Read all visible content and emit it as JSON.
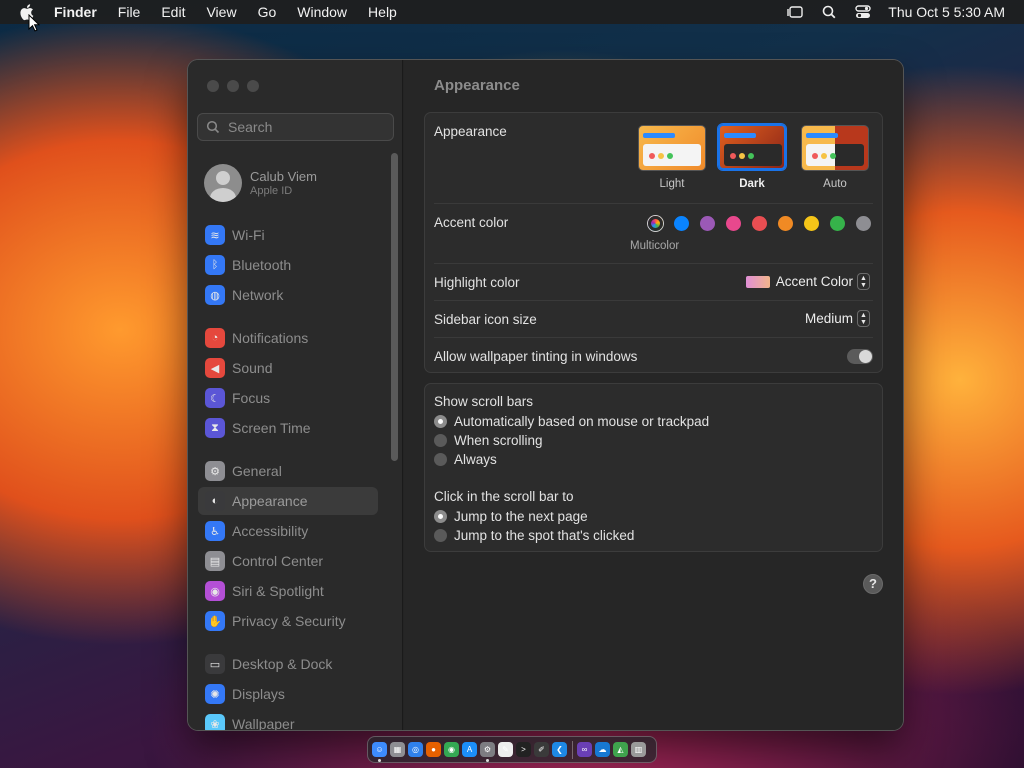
{
  "menubar": {
    "app": "Finder",
    "menus": [
      "File",
      "Edit",
      "View",
      "Go",
      "Window",
      "Help"
    ],
    "clock": "Thu Oct 5  5:30 AM"
  },
  "window": {
    "title": "Appearance",
    "search_placeholder": "Search",
    "account": {
      "name": "Calub Viem",
      "sub": "Apple ID"
    },
    "sidebar_items": [
      {
        "label": "Wi-Fi",
        "icon": "wifi-icon",
        "color": "#3478f6",
        "glyph": "≋"
      },
      {
        "label": "Bluetooth",
        "icon": "bluetooth-icon",
        "color": "#3478f6",
        "glyph": "ᛒ"
      },
      {
        "label": "Network",
        "icon": "globe-icon",
        "color": "#3478f6",
        "glyph": "◍"
      },
      {
        "label": "Notifications",
        "icon": "bell-icon",
        "color": "#e5483d",
        "glyph": "◔"
      },
      {
        "label": "Sound",
        "icon": "speaker-icon",
        "color": "#e5483d",
        "glyph": "◀"
      },
      {
        "label": "Focus",
        "icon": "moon-icon",
        "color": "#5b56d6",
        "glyph": "☾"
      },
      {
        "label": "Screen Time",
        "icon": "hourglass-icon",
        "color": "#5b56d6",
        "glyph": "⧗"
      },
      {
        "label": "General",
        "icon": "gear-icon",
        "color": "#8e8e93",
        "glyph": "⚙"
      },
      {
        "label": "Appearance",
        "icon": "appearance-icon",
        "color": "#3a3a3c",
        "glyph": "◐"
      },
      {
        "label": "Accessibility",
        "icon": "accessibility-icon",
        "color": "#3478f6",
        "glyph": "♿"
      },
      {
        "label": "Control Center",
        "icon": "control-center-icon",
        "color": "#8e8e93",
        "glyph": "▤"
      },
      {
        "label": "Siri & Spotlight",
        "icon": "siri-icon",
        "color": "#b44fd6",
        "glyph": "◉"
      },
      {
        "label": "Privacy & Security",
        "icon": "hand-icon",
        "color": "#3478f6",
        "glyph": "✋"
      },
      {
        "label": "Desktop & Dock",
        "icon": "dock-icon",
        "color": "#3a3a3c",
        "glyph": "▭"
      },
      {
        "label": "Displays",
        "icon": "sun-icon",
        "color": "#3478f6",
        "glyph": "✺"
      },
      {
        "label": "Wallpaper",
        "icon": "wallpaper-icon",
        "color": "#5ac8fa",
        "glyph": "❀"
      }
    ],
    "appearance": {
      "label": "Appearance",
      "options": [
        "Light",
        "Dark",
        "Auto"
      ],
      "selected": "Dark"
    },
    "accent": {
      "label": "Accent color",
      "multicolor_label": "Multicolor",
      "colors": [
        "#ffffff",
        "#0a84ff",
        "#9b59b6",
        "#e8488d",
        "#e94e52",
        "#f08a24",
        "#f5c518",
        "#36b34a",
        "#8e8e93"
      ]
    },
    "highlight": {
      "label": "Highlight color",
      "value": "Accent Color"
    },
    "sidebar_icon_size": {
      "label": "Sidebar icon size",
      "value": "Medium"
    },
    "tinting": {
      "label": "Allow wallpaper tinting in windows",
      "on": false
    },
    "scroll_bars": {
      "label": "Show scroll bars",
      "options": [
        "Automatically based on mouse or trackpad",
        "When scrolling",
        "Always"
      ],
      "selected": 0
    },
    "click_scroll": {
      "label": "Click in the scroll bar to",
      "options": [
        "Jump to the next page",
        "Jump to the spot that's clicked"
      ],
      "selected": 0
    },
    "help": "?"
  },
  "dock": {
    "apps": [
      {
        "name": "finder-icon",
        "color": "#3d8bfd",
        "glyph": "☺",
        "running": true
      },
      {
        "name": "launchpad-icon",
        "color": "#8e8e93",
        "glyph": "▦",
        "running": false
      },
      {
        "name": "safari-icon",
        "color": "#2f80ed",
        "glyph": "◎",
        "running": false
      },
      {
        "name": "firefox-icon",
        "color": "#e66000",
        "glyph": "●",
        "running": false
      },
      {
        "name": "chrome-icon",
        "color": "#34a853",
        "glyph": "◉",
        "running": false
      },
      {
        "name": "app-store-icon",
        "color": "#1c8ef9",
        "glyph": "A",
        "running": false
      },
      {
        "name": "system-settings-icon",
        "color": "#7d7d82",
        "glyph": "⚙",
        "running": true
      },
      {
        "name": "textedit-icon",
        "color": "#eeeeee",
        "glyph": "✎",
        "running": false
      },
      {
        "name": "terminal-icon",
        "color": "#222222",
        "glyph": ">",
        "running": false
      },
      {
        "name": "brush-icon",
        "color": "#3a3a3a",
        "glyph": "✐",
        "running": false
      },
      {
        "name": "vscode-icon",
        "color": "#1e88e5",
        "glyph": "❮",
        "running": false
      }
    ],
    "apps_right": [
      {
        "name": "visual-studio-icon",
        "color": "#6a3fb5",
        "glyph": "∞",
        "running": false
      },
      {
        "name": "onedrive-icon",
        "color": "#1778d2",
        "glyph": "☁",
        "running": false
      },
      {
        "name": "color-picker-icon",
        "color": "#3fa34d",
        "glyph": "◭",
        "running": false
      },
      {
        "name": "trash-icon",
        "color": "#9a9a9a",
        "glyph": "▥",
        "running": false
      }
    ]
  }
}
